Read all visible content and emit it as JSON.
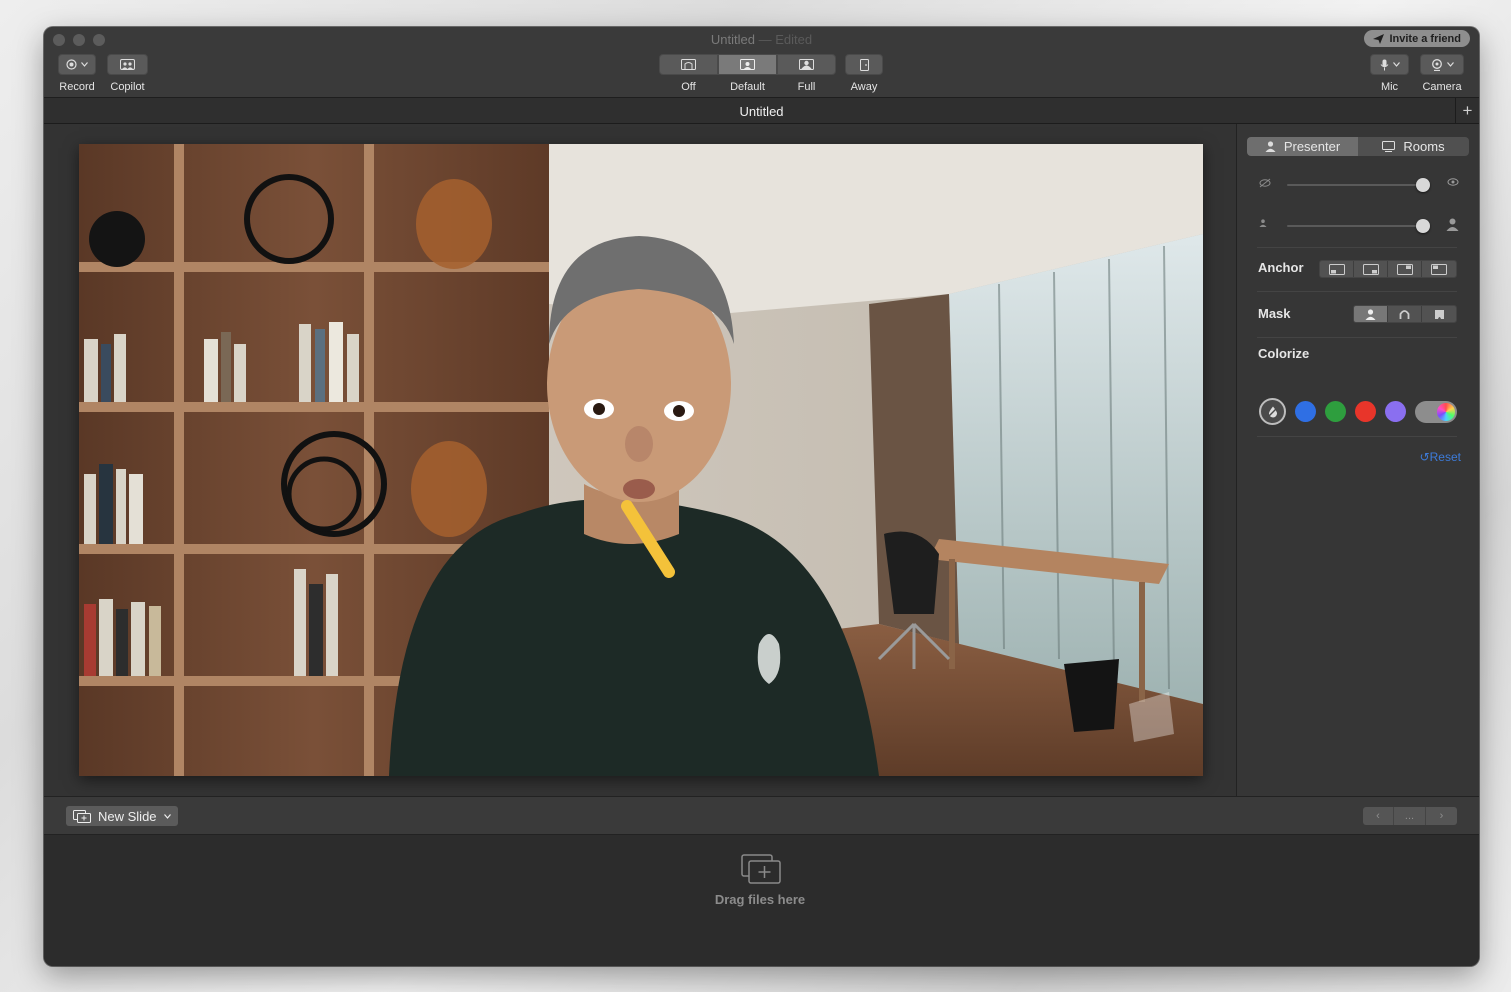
{
  "window": {
    "title": "Untitled",
    "title_suffix": "— Edited",
    "invite_label": "Invite a friend"
  },
  "toolbar": {
    "record_label": "Record",
    "copilot_label": "Copilot",
    "modes": [
      {
        "label": "Off",
        "active": false
      },
      {
        "label": "Default",
        "active": true
      },
      {
        "label": "Full",
        "active": false
      }
    ],
    "away_label": "Away",
    "mic_label": "Mic",
    "camera_label": "Camera"
  },
  "tab": {
    "title": "Untitled",
    "add_label": "+"
  },
  "panel": {
    "tabs": [
      {
        "label": "Presenter",
        "icon": "person-icon",
        "active": true
      },
      {
        "label": "Rooms",
        "icon": "monitor-icon",
        "active": false
      }
    ],
    "opacity_slider": {
      "value": 1.0,
      "left_icon": "eye-off-icon",
      "right_icon": "eye-icon"
    },
    "size_slider": {
      "value": 1.0,
      "left_icon": "person-small-icon",
      "right_icon": "person-large-icon"
    },
    "anchor_label": "Anchor",
    "mask_label": "Mask",
    "colorize_label": "Colorize",
    "swatches": [
      "#2f6fe4",
      "#2e9e3e",
      "#e8352a",
      "#8a6ff0"
    ],
    "reset_label": "Reset"
  },
  "bottom": {
    "new_slide_label": "New Slide",
    "pager_mid": "...",
    "drop_text": "Drag files here"
  }
}
